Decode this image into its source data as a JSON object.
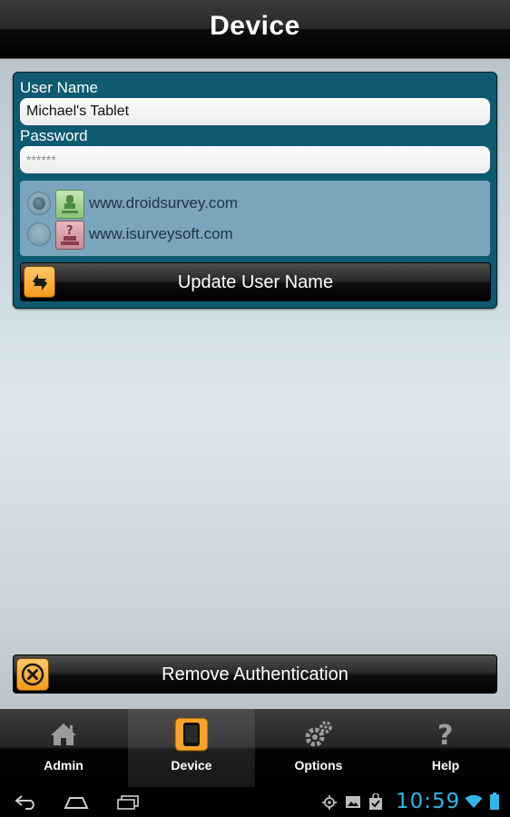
{
  "header": {
    "title": "Device"
  },
  "form": {
    "username_label": "User Name",
    "username_value": "Michael's Tablet",
    "password_label": "Password",
    "password_value": "******"
  },
  "servers": [
    {
      "label": "www.droidsurvey.com",
      "selected": true
    },
    {
      "label": "www.isurveysoft.com",
      "selected": false
    }
  ],
  "buttons": {
    "update_label": "Update User Name",
    "remove_label": "Remove Authentication"
  },
  "tabs": [
    {
      "label": "Admin",
      "icon": "home-icon",
      "active": false
    },
    {
      "label": "Device",
      "icon": "tablet-icon",
      "active": true
    },
    {
      "label": "Options",
      "icon": "gears-icon",
      "active": false
    },
    {
      "label": "Help",
      "icon": "question-icon",
      "active": false
    }
  ],
  "statusbar": {
    "time": "10:59"
  },
  "colors": {
    "accent": "#f39a1c",
    "panel": "#0e5a70",
    "clock": "#33b5e5"
  }
}
